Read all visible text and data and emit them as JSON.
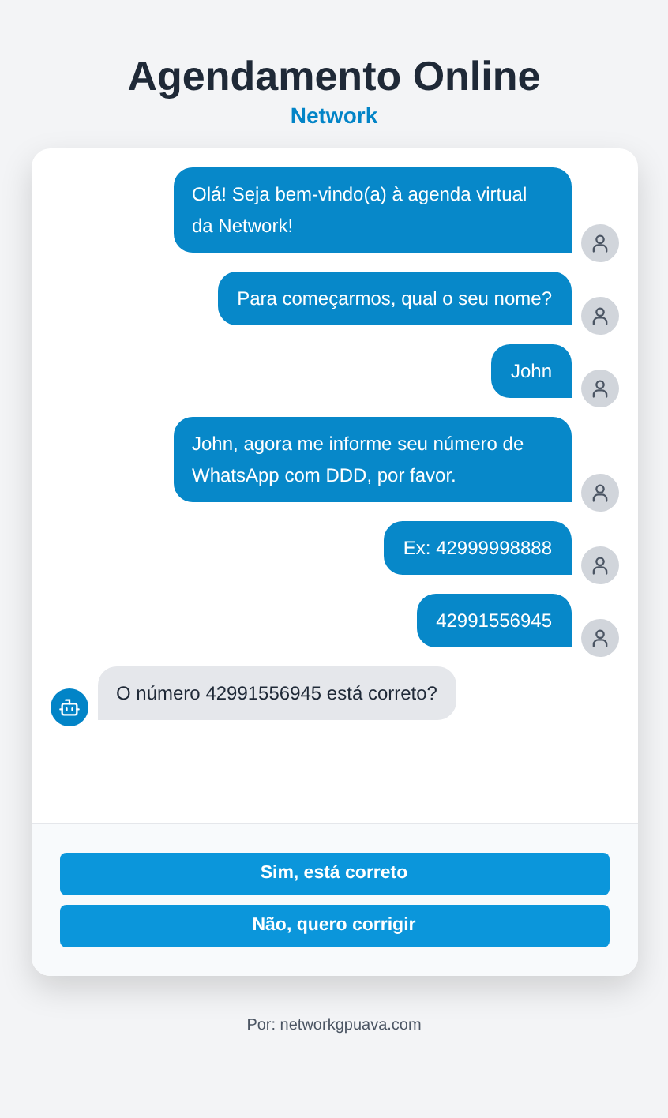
{
  "header": {
    "title": "Agendamento Online",
    "subtitle": "Network"
  },
  "messages": [
    {
      "kind": "user",
      "text": "Olá! Seja bem-vindo(a) à agenda virtual da Network!"
    },
    {
      "kind": "user",
      "text": "Para começarmos, qual o seu nome?"
    },
    {
      "kind": "user",
      "text": "John"
    },
    {
      "kind": "user",
      "text": "John, agora me informe seu número de WhatsApp com DDD, por favor."
    },
    {
      "kind": "user",
      "text": "Ex: 42999998888"
    },
    {
      "kind": "user",
      "text": "42991556945"
    },
    {
      "kind": "bot",
      "text": "O número 42991556945 está correto?"
    }
  ],
  "buttons": [
    "Sim, está correto",
    "Não, quero corrigir"
  ],
  "footer": "Por: networkgpuava.com"
}
